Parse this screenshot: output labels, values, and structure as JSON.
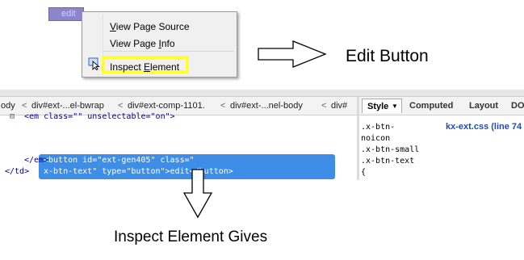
{
  "edit_button": {
    "label": "edit"
  },
  "context_menu": {
    "items": [
      {
        "pre": "",
        "accel": "V",
        "post": "iew Page Source"
      },
      {
        "pre": "View Page ",
        "accel": "I",
        "post": "nfo"
      },
      {
        "pre": "Inspect ",
        "accel": "E",
        "post": "lement"
      }
    ]
  },
  "annotations": {
    "edit_button_label": "Edit Button",
    "inspect_caption": "Inspect Element Gives"
  },
  "devtools": {
    "breadcrumb": [
      "ody",
      "div#ext-...el-bwrap",
      "div#ext-comp-1101.",
      "div#ext-...nel-body",
      "div#"
    ],
    "breadcrumb_sep": "<",
    "html_lines": {
      "em_open": "<em class=\"\" unselectable=\"on\">",
      "button_line1": "<button id=\"ext-gen405\" class=\"",
      "button_line2": "x-btn-text\" type=\"button\">edit</button>",
      "em_close": "</em>",
      "td_close": "</td>"
    },
    "side_tabs": {
      "style": "Style",
      "computed": "Computed",
      "layout": "Layout",
      "dom": "DO"
    },
    "css_lines": [
      ".x-btn-",
      "noicon",
      ".x-btn-small",
      ".x-btn-text",
      "{"
    ],
    "css_source": "kx-ext.css (line 74"
  }
}
